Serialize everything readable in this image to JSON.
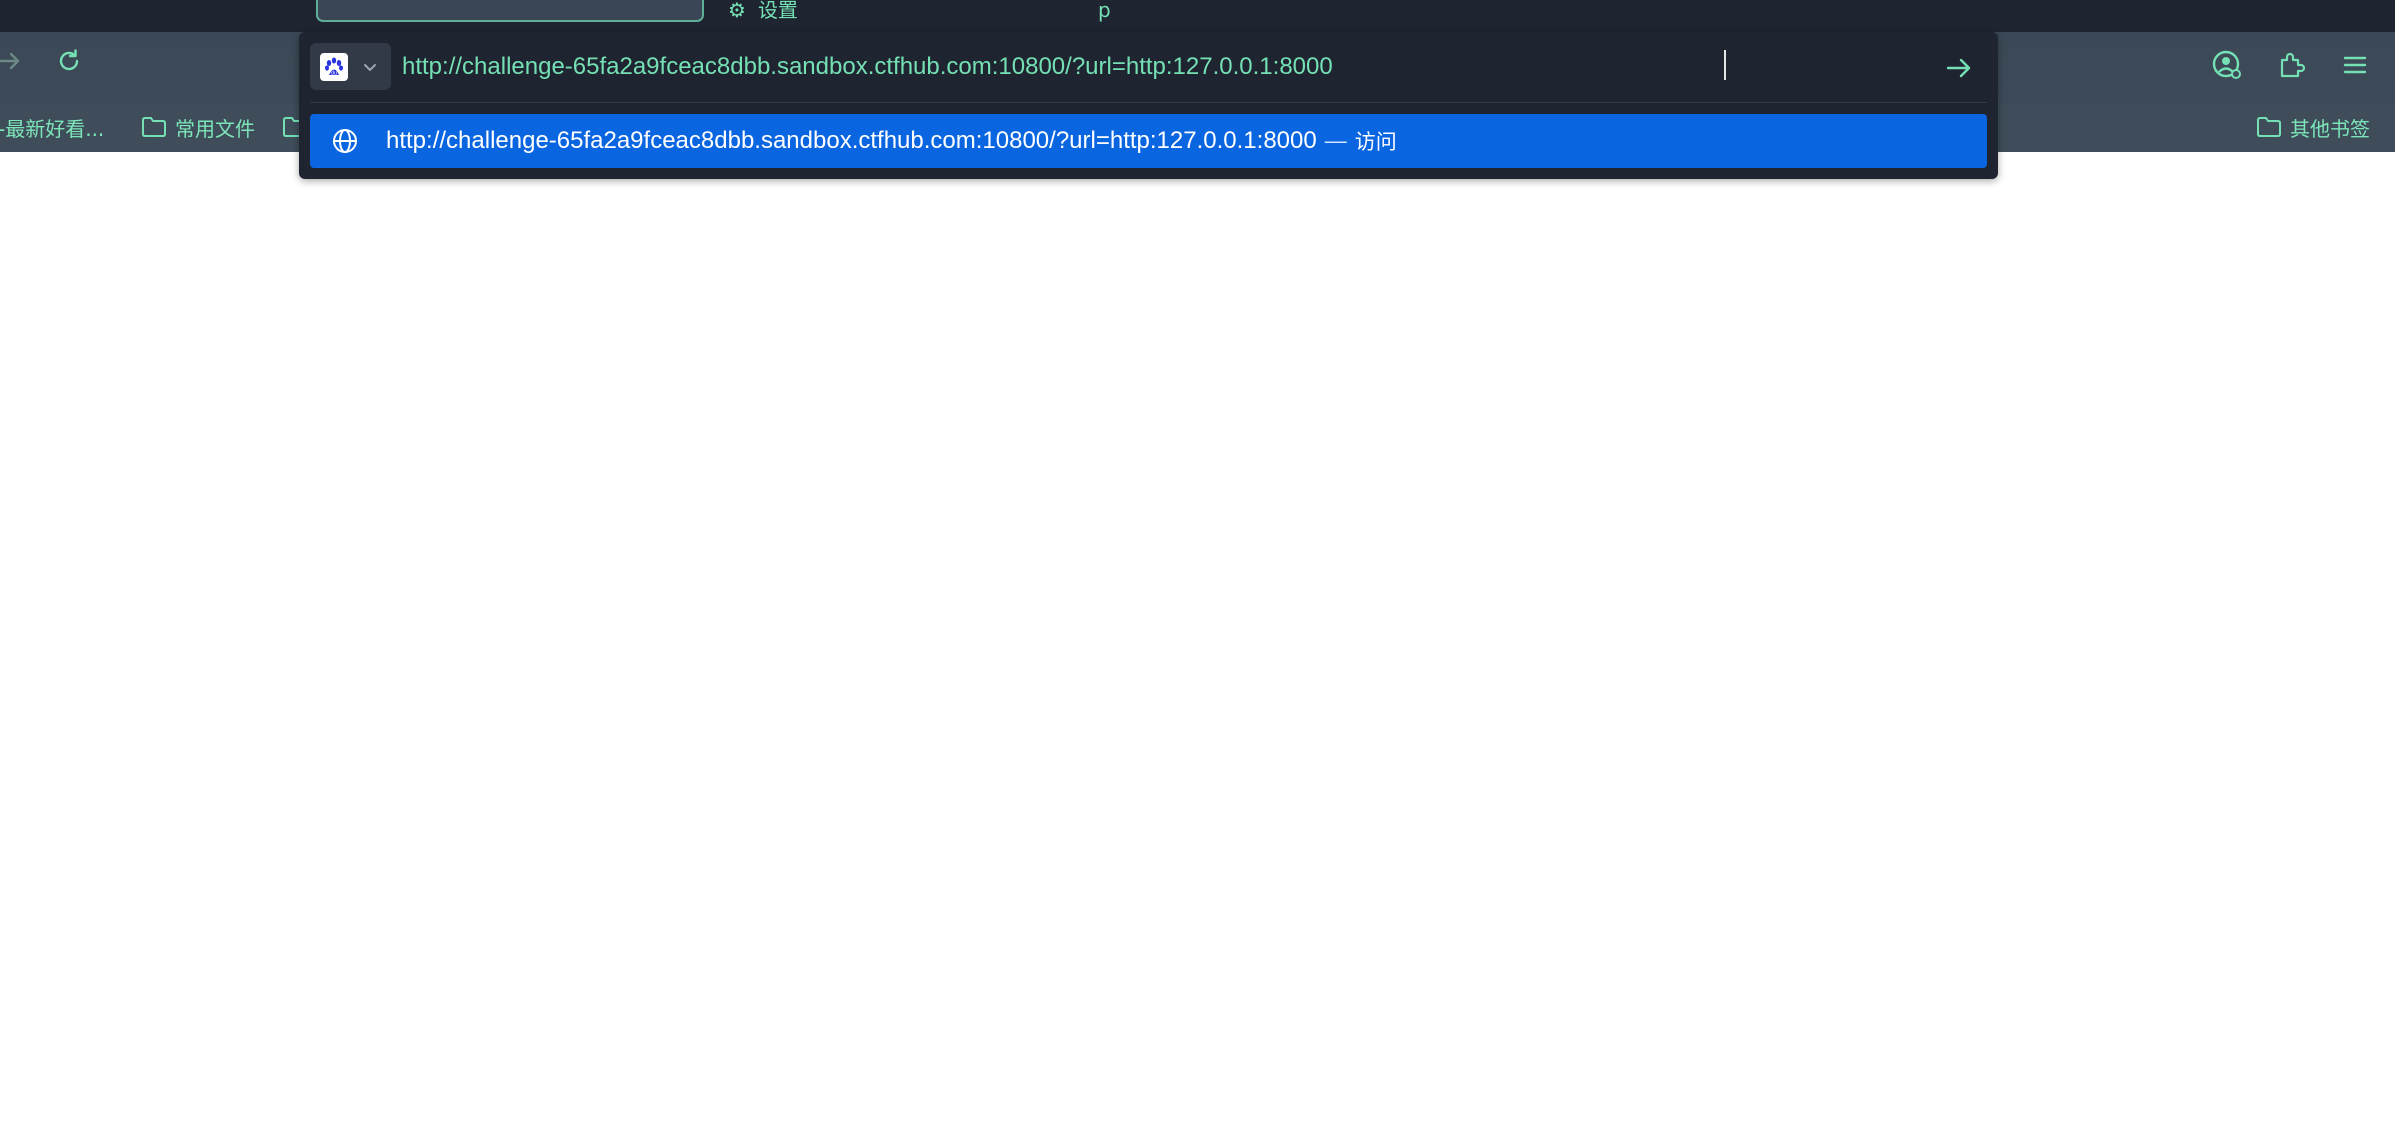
{
  "window": {
    "tab_fragment_left": "设置",
    "tab_fragment_right": "p"
  },
  "toolbar": {
    "back_icon": "arrow-right-icon",
    "reload_icon": "reload-icon"
  },
  "bookmarks": {
    "items": [
      {
        "label": "-最新好看...",
        "icon": "none"
      },
      {
        "label": "常用文件",
        "icon": "folder-icon"
      },
      {
        "label": "",
        "icon": "folder-icon"
      }
    ],
    "other_label": "其他书签"
  },
  "urlbar": {
    "value": "http://challenge-65fa2a9fceac8dbb.sandbox.ctfhub.com:10800/?url=http:127.0.0.1:8000",
    "engine_icon": "baidu-paw-icon",
    "go_icon": "arrow-right-icon"
  },
  "suggestion": {
    "url": "http://challenge-65fa2a9fceac8dbb.sandbox.ctfhub.com:10800/?url=http:127.0.0.1:8000",
    "separator": "—",
    "action": "访问",
    "icon": "globe-icon"
  },
  "colors": {
    "accent_green": "#74e0b4",
    "highlight_blue": "#0a65e0",
    "panel_bg": "#1f2530",
    "toolbar_bg": "#3e4c5a"
  }
}
